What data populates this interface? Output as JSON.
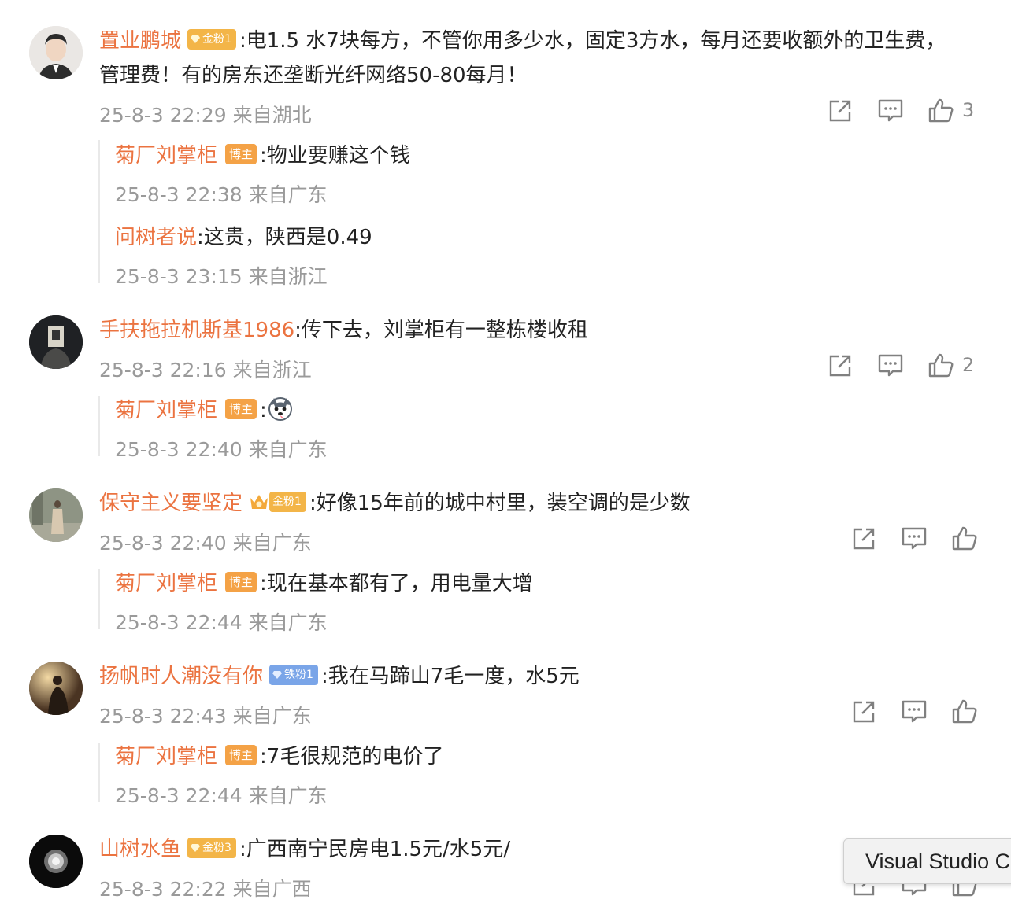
{
  "comments": [
    {
      "user": "置业鹏城",
      "badge": "金粉1",
      "text_line1": ":电1.5  水7块每方，不管你用多少水，固定3方水，每月还要收额外的卫生费，",
      "text_line2": "管理费！有的房东还垄断光纤网络50-80每月！",
      "meta": "25-8-3 22:29 来自湖北",
      "likes": "3",
      "replies": [
        {
          "user": "菊厂刘掌柜",
          "host_badge": "博主",
          "text": ":物业要赚这个钱",
          "meta": "25-8-3 22:38 来自广东"
        },
        {
          "user": "问树者说",
          "text": ":这贵，陕西是0.49",
          "meta": "25-8-3 23:15 来自浙江"
        }
      ]
    },
    {
      "user": "手扶拖拉机斯基1986",
      "text": ":传下去，刘掌柜有一整栋楼收租",
      "meta": "25-8-3 22:16 来自浙江",
      "likes": "2",
      "replies": [
        {
          "user": "菊厂刘掌柜",
          "host_badge": "博主",
          "text": ":",
          "emoji": "husky-emoji",
          "meta": "25-8-3 22:40 来自广东"
        }
      ]
    },
    {
      "user": "保守主义要坚定",
      "badge": "金粉1",
      "text": ":好像15年前的城中村里，装空调的是少数",
      "meta": "25-8-3 22:40 来自广东",
      "replies": [
        {
          "user": "菊厂刘掌柜",
          "host_badge": "博主",
          "text": ":现在基本都有了，用电量大增",
          "meta": "25-8-3 22:44 来自广东"
        }
      ]
    },
    {
      "user": "扬帆时人潮没有你",
      "badge": "铁粉1",
      "text": ":我在马蹄山7毛一度，水5元",
      "meta": "25-8-3 22:43 来自广东",
      "replies": [
        {
          "user": "菊厂刘掌柜",
          "host_badge": "博主",
          "text": ":7毛很规范的电价了",
          "meta": "25-8-3 22:44 来自广东"
        }
      ]
    },
    {
      "user": "山树水鱼",
      "badge": "金粉3",
      "text": ":广西南宁民房电1.5元/水5元/",
      "meta": "25-8-3 22:22 来自广西"
    }
  ],
  "tooltip": "Visual Studio C",
  "colors": {
    "username": "#eb7340",
    "meta": "#9a9a9a",
    "gold_badge": "#f3b548",
    "iron_badge": "#7aa5e8",
    "host_badge": "#f4a246"
  },
  "icons": [
    "share-icon",
    "comment-icon",
    "like-icon"
  ]
}
